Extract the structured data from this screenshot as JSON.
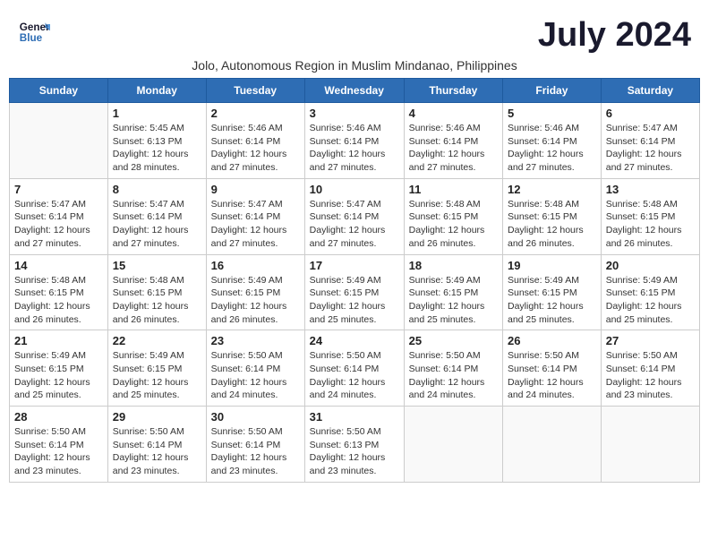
{
  "header": {
    "logo_line1": "General",
    "logo_line2": "Blue",
    "month_title": "July 2024",
    "subtitle": "Jolo, Autonomous Region in Muslim Mindanao, Philippines"
  },
  "days_of_week": [
    "Sunday",
    "Monday",
    "Tuesday",
    "Wednesday",
    "Thursday",
    "Friday",
    "Saturday"
  ],
  "weeks": [
    [
      {
        "day": "",
        "info": ""
      },
      {
        "day": "1",
        "info": "Sunrise: 5:45 AM\nSunset: 6:13 PM\nDaylight: 12 hours\nand 28 minutes."
      },
      {
        "day": "2",
        "info": "Sunrise: 5:46 AM\nSunset: 6:14 PM\nDaylight: 12 hours\nand 27 minutes."
      },
      {
        "day": "3",
        "info": "Sunrise: 5:46 AM\nSunset: 6:14 PM\nDaylight: 12 hours\nand 27 minutes."
      },
      {
        "day": "4",
        "info": "Sunrise: 5:46 AM\nSunset: 6:14 PM\nDaylight: 12 hours\nand 27 minutes."
      },
      {
        "day": "5",
        "info": "Sunrise: 5:46 AM\nSunset: 6:14 PM\nDaylight: 12 hours\nand 27 minutes."
      },
      {
        "day": "6",
        "info": "Sunrise: 5:47 AM\nSunset: 6:14 PM\nDaylight: 12 hours\nand 27 minutes."
      }
    ],
    [
      {
        "day": "7",
        "info": "Sunrise: 5:47 AM\nSunset: 6:14 PM\nDaylight: 12 hours\nand 27 minutes."
      },
      {
        "day": "8",
        "info": "Sunrise: 5:47 AM\nSunset: 6:14 PM\nDaylight: 12 hours\nand 27 minutes."
      },
      {
        "day": "9",
        "info": "Sunrise: 5:47 AM\nSunset: 6:14 PM\nDaylight: 12 hours\nand 27 minutes."
      },
      {
        "day": "10",
        "info": "Sunrise: 5:47 AM\nSunset: 6:14 PM\nDaylight: 12 hours\nand 27 minutes."
      },
      {
        "day": "11",
        "info": "Sunrise: 5:48 AM\nSunset: 6:15 PM\nDaylight: 12 hours\nand 26 minutes."
      },
      {
        "day": "12",
        "info": "Sunrise: 5:48 AM\nSunset: 6:15 PM\nDaylight: 12 hours\nand 26 minutes."
      },
      {
        "day": "13",
        "info": "Sunrise: 5:48 AM\nSunset: 6:15 PM\nDaylight: 12 hours\nand 26 minutes."
      }
    ],
    [
      {
        "day": "14",
        "info": "Sunrise: 5:48 AM\nSunset: 6:15 PM\nDaylight: 12 hours\nand 26 minutes."
      },
      {
        "day": "15",
        "info": "Sunrise: 5:48 AM\nSunset: 6:15 PM\nDaylight: 12 hours\nand 26 minutes."
      },
      {
        "day": "16",
        "info": "Sunrise: 5:49 AM\nSunset: 6:15 PM\nDaylight: 12 hours\nand 26 minutes."
      },
      {
        "day": "17",
        "info": "Sunrise: 5:49 AM\nSunset: 6:15 PM\nDaylight: 12 hours\nand 25 minutes."
      },
      {
        "day": "18",
        "info": "Sunrise: 5:49 AM\nSunset: 6:15 PM\nDaylight: 12 hours\nand 25 minutes."
      },
      {
        "day": "19",
        "info": "Sunrise: 5:49 AM\nSunset: 6:15 PM\nDaylight: 12 hours\nand 25 minutes."
      },
      {
        "day": "20",
        "info": "Sunrise: 5:49 AM\nSunset: 6:15 PM\nDaylight: 12 hours\nand 25 minutes."
      }
    ],
    [
      {
        "day": "21",
        "info": "Sunrise: 5:49 AM\nSunset: 6:15 PM\nDaylight: 12 hours\nand 25 minutes."
      },
      {
        "day": "22",
        "info": "Sunrise: 5:49 AM\nSunset: 6:15 PM\nDaylight: 12 hours\nand 25 minutes."
      },
      {
        "day": "23",
        "info": "Sunrise: 5:50 AM\nSunset: 6:14 PM\nDaylight: 12 hours\nand 24 minutes."
      },
      {
        "day": "24",
        "info": "Sunrise: 5:50 AM\nSunset: 6:14 PM\nDaylight: 12 hours\nand 24 minutes."
      },
      {
        "day": "25",
        "info": "Sunrise: 5:50 AM\nSunset: 6:14 PM\nDaylight: 12 hours\nand 24 minutes."
      },
      {
        "day": "26",
        "info": "Sunrise: 5:50 AM\nSunset: 6:14 PM\nDaylight: 12 hours\nand 24 minutes."
      },
      {
        "day": "27",
        "info": "Sunrise: 5:50 AM\nSunset: 6:14 PM\nDaylight: 12 hours\nand 23 minutes."
      }
    ],
    [
      {
        "day": "28",
        "info": "Sunrise: 5:50 AM\nSunset: 6:14 PM\nDaylight: 12 hours\nand 23 minutes."
      },
      {
        "day": "29",
        "info": "Sunrise: 5:50 AM\nSunset: 6:14 PM\nDaylight: 12 hours\nand 23 minutes."
      },
      {
        "day": "30",
        "info": "Sunrise: 5:50 AM\nSunset: 6:14 PM\nDaylight: 12 hours\nand 23 minutes."
      },
      {
        "day": "31",
        "info": "Sunrise: 5:50 AM\nSunset: 6:13 PM\nDaylight: 12 hours\nand 23 minutes."
      },
      {
        "day": "",
        "info": ""
      },
      {
        "day": "",
        "info": ""
      },
      {
        "day": "",
        "info": ""
      }
    ]
  ]
}
